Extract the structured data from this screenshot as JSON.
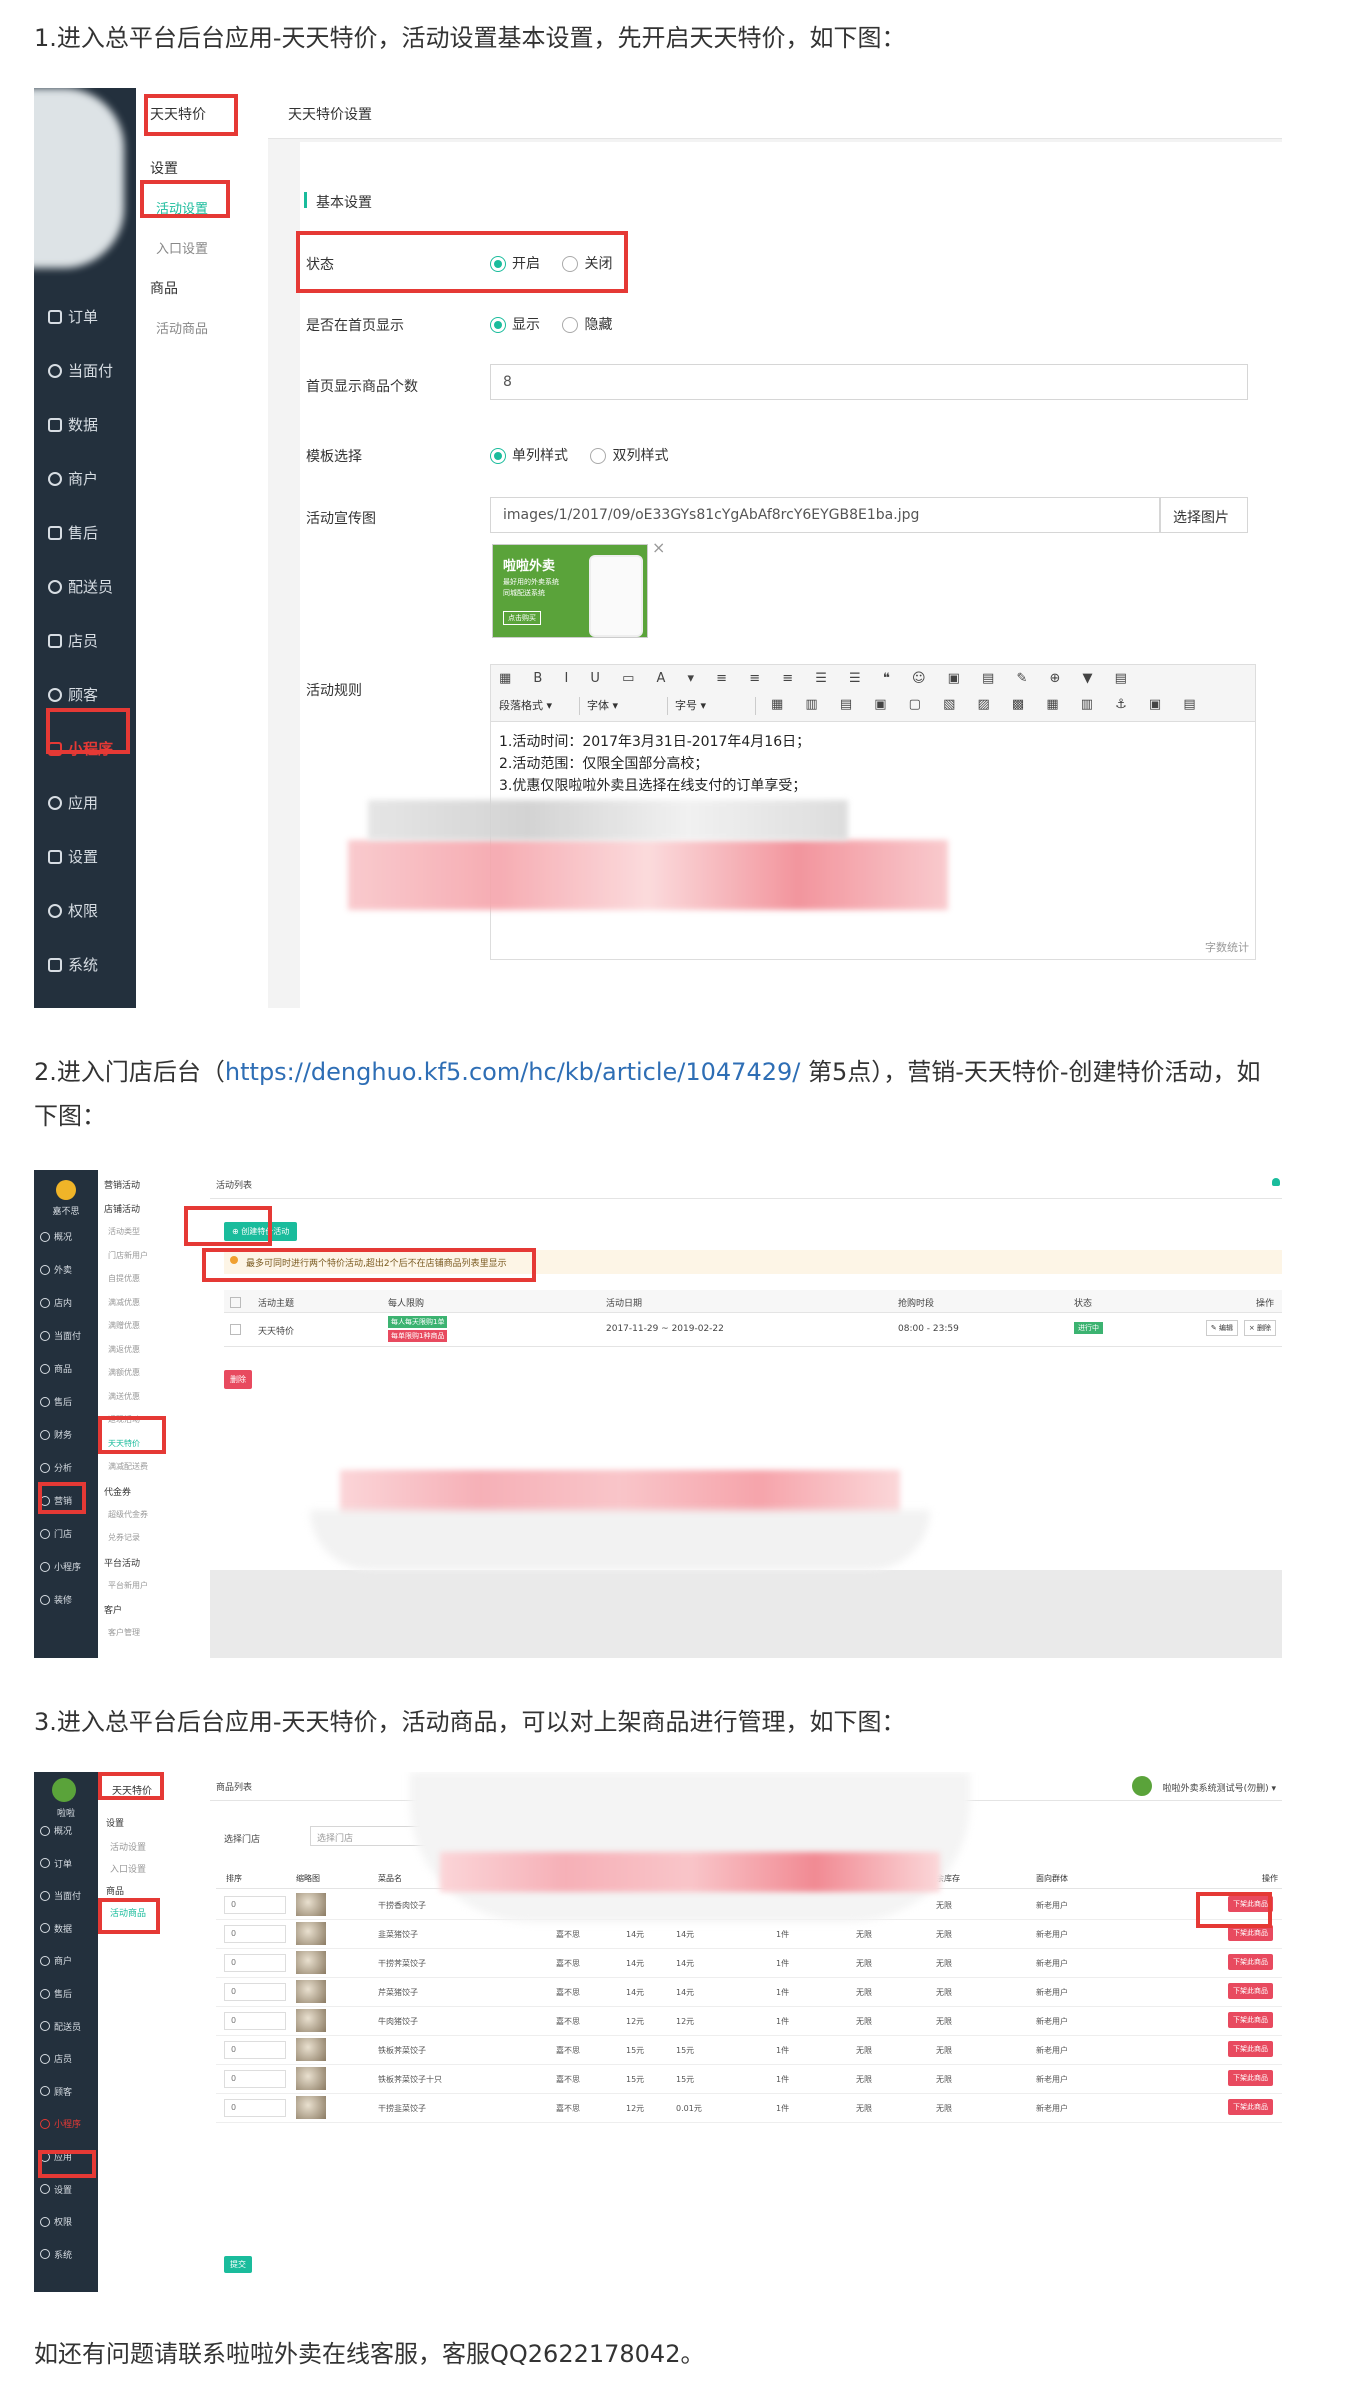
{
  "step1": {
    "text": "1.进入总平台后台应用-天天特价，活动设置基本设置，先开启天天特价，如下图："
  },
  "step2": {
    "text_before": "2.进入门店后台（",
    "link": "https://denghuo.kf5.com/hc/kb/article/1047429/",
    "text_after": " 第5点），营销-天天特价-创建特价活动，如下图："
  },
  "step3": {
    "text": "3.进入总平台后台应用-天天特价，活动商品，可以对上架商品进行管理，如下图："
  },
  "footer": {
    "text": "如还有问题请联系啦啦外卖在线客服，客服QQ2622178042。"
  },
  "shot1": {
    "sidebar": [
      "订单",
      "当面付",
      "数据",
      "商户",
      "售后",
      "配送员",
      "店员",
      "顾客",
      "小程序",
      "应用",
      "设置",
      "权限",
      "系统"
    ],
    "sub_title": "天天特价",
    "sub_items": [
      "设置",
      "活动设置",
      "入口设置",
      "商品",
      "活动商品"
    ],
    "page_title": "天天特价设置",
    "section": "基本设置",
    "status_label": "状态",
    "status_on": "开启",
    "status_off": "关闭",
    "home_label": "是否在首页显示",
    "home_show": "显示",
    "home_hide": "隐藏",
    "count_label": "首页显示商品个数",
    "count_value": "8",
    "tpl_label": "模板选择",
    "tpl_single": "单列样式",
    "tpl_double": "双列样式",
    "banner_label": "活动宣传图",
    "banner_path": "images/1/2017/09/oE33GYs81cYgAbAf8rcY6EYGB8E1ba.jpg",
    "banner_btn": "选择图片",
    "banner_img_title": "啦啦外卖",
    "banner_img_sub1": "最好用的外卖系统",
    "banner_img_sub2": "同城配送系统",
    "banner_img_btn": "点击购买",
    "rules_label": "活动规则",
    "editor_sel1": "段落格式",
    "editor_sel2": "字体",
    "editor_sel3": "字号",
    "rules_lines": [
      "1.活动时间：2017年3月31日-2017年4月16日；",
      "2.活动范围：仅限全国部分高校；",
      "3.优惠仅限啦啦外卖且选择在线支付的订单享受；"
    ],
    "word_count": "字数统计"
  },
  "shot2": {
    "brand": "嘉不思",
    "sidebar": [
      "概况",
      "外卖",
      "店内",
      "当面付",
      "商品",
      "售后",
      "财务",
      "分析",
      "营销",
      "门店",
      "小程序",
      "装修"
    ],
    "sub_groups": [
      {
        "title": "营销活动",
        "items": []
      },
      {
        "title": "店铺活动",
        "items": [
          "活动类型",
          "门店新用户",
          "自提优惠",
          "满减优惠",
          "满赠优惠",
          "满返优惠",
          "满额优惠",
          "满送优惠",
          "返现活动",
          "天天特价",
          "满减配送费"
        ]
      },
      {
        "title": "代金券",
        "items": [
          "超级代金券",
          "兑券记录"
        ]
      },
      {
        "title": "平台活动",
        "items": [
          "平台新用户"
        ]
      },
      {
        "title": "客户",
        "items": [
          "客户管理"
        ]
      }
    ],
    "page_title": "活动列表",
    "create_btn": "创建特价活动",
    "notice": "最多可同时进行两个特价活动,超出2个后不在店铺商品列表里显示",
    "columns": [
      "活动主题",
      "每人限购",
      "活动日期",
      "抢购时段",
      "状态",
      "操作"
    ],
    "row": {
      "name": "天天特价",
      "tag1": "每人每天限购1单",
      "tag2": "每单限购1种商品",
      "date": "2017-11-29 ~ 2019-02-22",
      "time": "08:00 - 23:59",
      "status": "进行中",
      "edit": "编辑",
      "del": "删除"
    },
    "delete_btn": "删除"
  },
  "shot3": {
    "brand": "啦啦",
    "sidebar": [
      "概况",
      "订单",
      "当面付",
      "数据",
      "商户",
      "售后",
      "配送员",
      "店员",
      "顾客",
      "小程序",
      "应用",
      "设置",
      "权限",
      "系统"
    ],
    "sub_title": "天天特价",
    "sub_items": [
      "设置",
      "活动设置",
      "入口设置",
      "商品",
      "活动商品"
    ],
    "page_title": "商品列表",
    "account": "啦啦外卖系统测试号(勿删)",
    "filter_label": "选择门店",
    "filter_placeholder": "选择门店",
    "columns": [
      "排序",
      "缩略图",
      "菜品名",
      "",
      "",
      "",
      "",
      "",
      "余库存",
      "面向群体",
      "操作"
    ],
    "rows": [
      {
        "sort": "0",
        "name": "干捞香肉饺子",
        "shop": "",
        "p1": "",
        "p2": "",
        "limit": "",
        "stock": "",
        "left": "无限",
        "group": "新老用户",
        "op": "下架此商品"
      },
      {
        "sort": "0",
        "name": "韭菜猪饺子",
        "shop": "嘉不思",
        "p1": "14元",
        "p2": "14元",
        "limit": "1件",
        "stock": "无限",
        "left": "无限",
        "group": "新老用户",
        "op": "下架此商品"
      },
      {
        "sort": "0",
        "name": "干捞荠菜饺子",
        "shop": "嘉不思",
        "p1": "14元",
        "p2": "14元",
        "limit": "1件",
        "stock": "无限",
        "left": "无限",
        "group": "新老用户",
        "op": "下架此商品"
      },
      {
        "sort": "0",
        "name": "芹菜猪饺子",
        "shop": "嘉不思",
        "p1": "14元",
        "p2": "14元",
        "limit": "1件",
        "stock": "无限",
        "left": "无限",
        "group": "新老用户",
        "op": "下架此商品"
      },
      {
        "sort": "0",
        "name": "牛肉猪饺子",
        "shop": "嘉不思",
        "p1": "12元",
        "p2": "12元",
        "limit": "1件",
        "stock": "无限",
        "left": "无限",
        "group": "新老用户",
        "op": "下架此商品"
      },
      {
        "sort": "0",
        "name": "铁板荠菜饺子",
        "shop": "嘉不思",
        "p1": "15元",
        "p2": "15元",
        "limit": "1件",
        "stock": "无限",
        "left": "无限",
        "group": "新老用户",
        "op": "下架此商品"
      },
      {
        "sort": "0",
        "name": "铁板荠菜饺子十只",
        "shop": "嘉不思",
        "p1": "15元",
        "p2": "15元",
        "limit": "1件",
        "stock": "无限",
        "left": "无限",
        "group": "新老用户",
        "op": "下架此商品"
      },
      {
        "sort": "0",
        "name": "干捞韭菜饺子",
        "shop": "嘉不思",
        "p1": "12元",
        "p2": "0.01元",
        "limit": "1件",
        "stock": "无限",
        "left": "无限",
        "group": "新老用户",
        "op": "下架此商品"
      }
    ],
    "submit": "提交"
  }
}
